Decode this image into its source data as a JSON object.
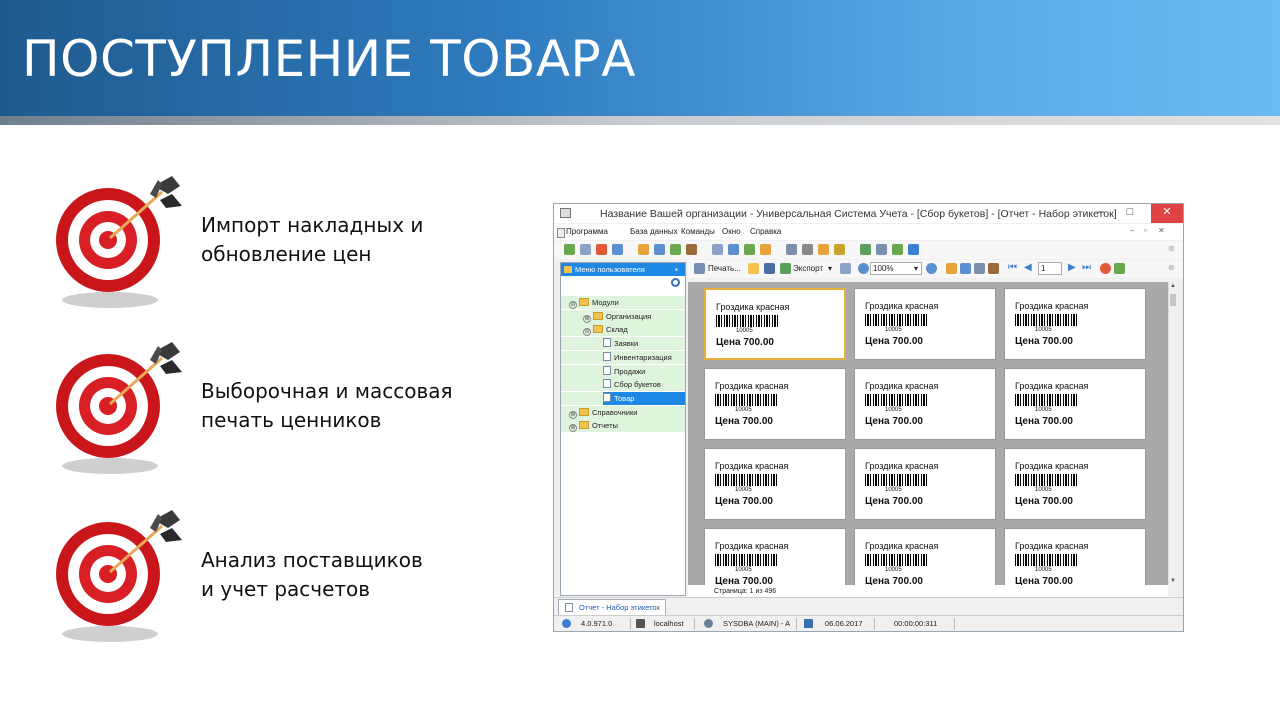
{
  "slide": {
    "title": "ПОСТУПЛЕНИЕ ТОВАРА",
    "features": [
      {
        "line1": "Импорт накладных и",
        "line2": "обновление цен",
        "icon": "dart-target-icon"
      },
      {
        "line1": "Выборочная и массовая",
        "line2": "печать ценников",
        "icon": "dart-target-icon"
      },
      {
        "line1": "Анализ поставщиков",
        "line2": "и учет расчетов",
        "icon": "dart-target-icon"
      }
    ]
  },
  "window": {
    "title": "Название Вашей организации - Универсальная Система Учета - [Сбор букетов] - [Отчет - Набор этикеток]",
    "controls": {
      "minimize": "–",
      "maximize": "□",
      "close": "✕"
    },
    "menu": [
      "Программа",
      "База данных",
      "Команды",
      "Окно",
      "Справка"
    ],
    "toolbar2": {
      "print": "Печать...",
      "export": "Экспорт",
      "zoom": "100%",
      "page": "1"
    },
    "sidebar": {
      "header": "Меню пользователя",
      "items": [
        {
          "label": "Модули",
          "type": "folder",
          "exp": "⊖"
        },
        {
          "label": "Организация",
          "type": "folder",
          "exp": "⊕"
        },
        {
          "label": "Склад",
          "type": "folder",
          "exp": "⊖"
        },
        {
          "label": "Заявки",
          "type": "doc"
        },
        {
          "label": "Инвентаризация",
          "type": "doc"
        },
        {
          "label": "Продажи",
          "type": "doc"
        },
        {
          "label": "Сбор букетов",
          "type": "doc"
        },
        {
          "label": "Товар",
          "type": "doc",
          "selected": true
        },
        {
          "label": "Справочники",
          "type": "folder",
          "exp": "⊕"
        },
        {
          "label": "Отчеты",
          "type": "folder",
          "exp": "⊕"
        }
      ]
    },
    "labels": [
      {
        "name": "Гроздика красная",
        "code": "10005",
        "price": "Цена 700.00"
      }
    ],
    "page_info": "Страница: 1 из 496",
    "tab": "Отчет - Набор этикеток",
    "status": {
      "version": "4.0.971.0",
      "server": "localhost",
      "user": "SYSDBA (MAIN) - A",
      "date": "06.06.2017",
      "time": "00:00:00:311"
    },
    "colors": {
      "accent": "#1e88e5",
      "selected_border": "#e6b13a",
      "close": "#e04343"
    }
  }
}
